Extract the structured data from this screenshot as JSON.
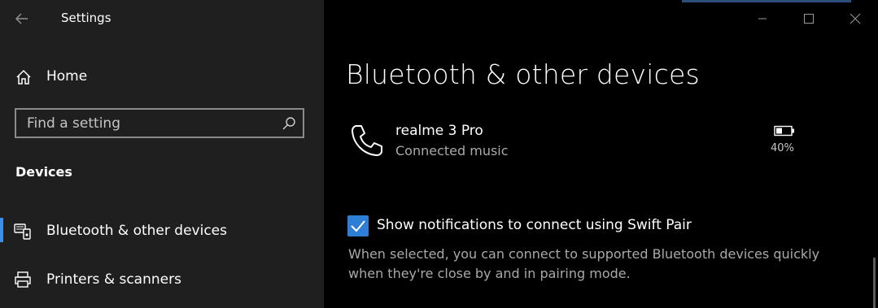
{
  "window": {
    "title": "Settings"
  },
  "sidebar": {
    "home_label": "Home",
    "search_placeholder": "Find a setting",
    "section_heading": "Devices",
    "items": [
      {
        "label": "Bluetooth & other devices",
        "selected": true,
        "icon": "bluetooth-devices-icon"
      },
      {
        "label": "Printers & scanners",
        "selected": false,
        "icon": "printer-icon"
      }
    ]
  },
  "main": {
    "page_title": "Bluetooth & other devices",
    "device": {
      "name": "realme 3 Pro",
      "status": "Connected music",
      "icon": "phone-icon",
      "battery": "40%"
    },
    "swift_pair": {
      "checked": true,
      "label": "Show notifications to connect using Swift Pair",
      "description": "When selected, you can connect to supported Bluetooth devices quickly when they're close by and in pairing mode."
    }
  },
  "colors": {
    "sidebar_bg": "#1f1f1f",
    "main_bg": "#000000",
    "accent": "#2d7fd6",
    "secondary_text": "#a9a9a9"
  }
}
